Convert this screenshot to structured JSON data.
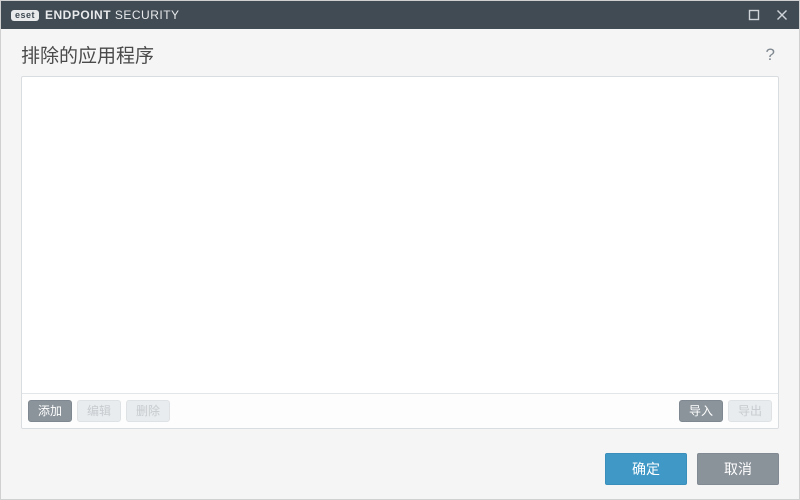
{
  "titlebar": {
    "brand_badge": "eset",
    "brand_strong": "ENDPOINT",
    "brand_rest": " SECURITY"
  },
  "header": {
    "title": "排除的应用程序",
    "help_symbol": "?"
  },
  "list_toolbar": {
    "add_label": "添加",
    "edit_label": "编辑",
    "delete_label": "删除",
    "import_label": "导入",
    "export_label": "导出"
  },
  "footer": {
    "ok_label": "确定",
    "cancel_label": "取消"
  }
}
